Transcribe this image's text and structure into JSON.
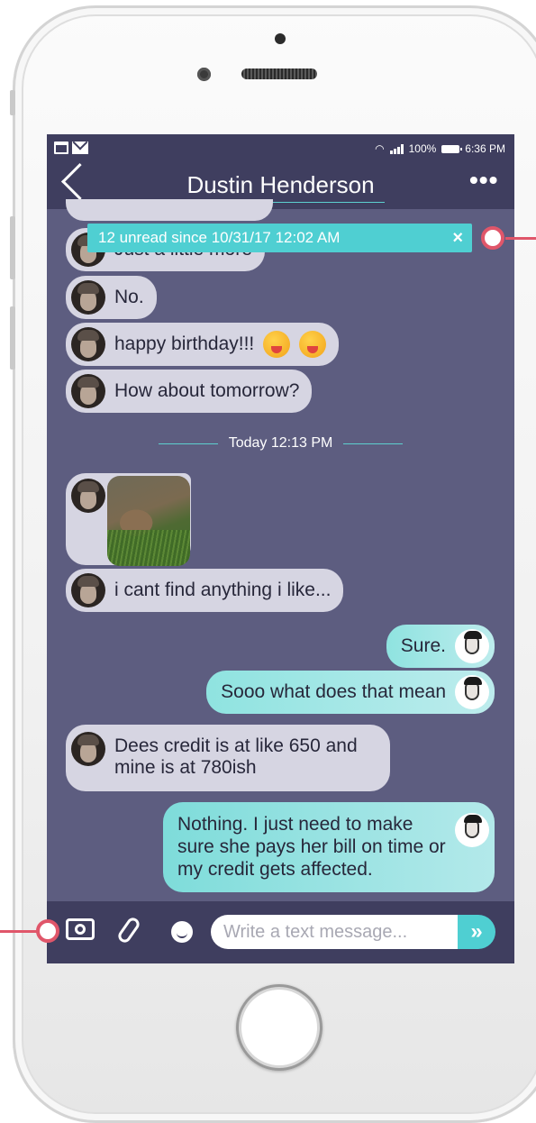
{
  "status_bar": {
    "battery": "100%",
    "time": "6:36 PM"
  },
  "header": {
    "back_icon": "chevron-left-icon",
    "contact_name": "Dustin Henderson",
    "menu_icon": "ellipsis-icon"
  },
  "unread_banner": {
    "text": "12 unread since 10/31/17 12:02 AM",
    "close_icon": "×"
  },
  "messages_before": [
    {
      "text": "Just a little more",
      "direction": "in"
    },
    {
      "text": "No.",
      "direction": "in"
    },
    {
      "text": "happy birthday!!!",
      "direction": "in",
      "emojis": 2
    },
    {
      "text": "How about tomorrow?",
      "direction": "in"
    }
  ],
  "time_divider": "Today 12:13 PM",
  "messages_after": [
    {
      "type": "photo",
      "direction": "in"
    },
    {
      "text": "i cant find anything i like...",
      "direction": "in"
    },
    {
      "text": "Sure.",
      "direction": "out"
    },
    {
      "text": "Sooo what does that mean",
      "direction": "out"
    },
    {
      "text": "Dees credit is at like 650 and mine is at 780ish",
      "direction": "in"
    },
    {
      "text": "Nothing. I just need to make sure she pays her bill on time or my credit gets affected.",
      "direction": "out"
    }
  ],
  "input_bar": {
    "placeholder": "Write a text message...",
    "send_glyph": "»"
  },
  "colors": {
    "screen_bg": "#5d5d80",
    "header_bg": "#3f3e5f",
    "accent": "#4fcfd2",
    "incoming_bubble": "#d6d5e2",
    "callout": "#e0566a"
  }
}
